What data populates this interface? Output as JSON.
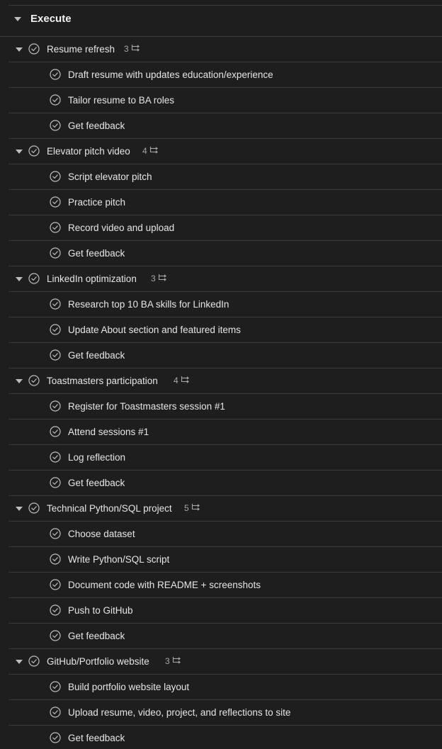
{
  "section": {
    "title": "Execute"
  },
  "groups": [
    {
      "title": "Resume refresh",
      "count": "3",
      "items": [
        "Draft resume with updates education/experience",
        "Tailor resume to BA roles",
        "Get feedback"
      ]
    },
    {
      "title": "Elevator pitch video",
      "count": "4",
      "items": [
        "Script elevator pitch",
        "Practice pitch",
        "Record video and upload",
        "Get feedback"
      ]
    },
    {
      "title": "LinkedIn optimization",
      "count": "3",
      "items": [
        "Research top 10 BA skills for LinkedIn",
        "Update About section and featured items",
        "Get feedback"
      ]
    },
    {
      "title": "Toastmasters participation",
      "count": "4",
      "items": [
        "Register for Toastmasters session #1",
        "Attend sessions #1",
        "Log reflection",
        "Get feedback"
      ]
    },
    {
      "title": "Technical Python/SQL project",
      "count": "5",
      "items": [
        "Choose dataset",
        "Write Python/SQL script",
        "Document code with README + screenshots",
        "Push to GitHub",
        "Get feedback"
      ]
    },
    {
      "title": "GitHub/Portfolio website",
      "count": "3",
      "items": [
        "Build portfolio website layout",
        "Upload resume, video, project, and reflections to site",
        "Get feedback"
      ]
    }
  ],
  "icons": {
    "check": "check-circle-icon",
    "subtasks": "subtask-icon",
    "expand": "chevron-down-icon"
  },
  "colors": {
    "background": "#1e1e1e",
    "divider": "#3a3a3a",
    "text": "#e6e6e6",
    "muted": "#a8a8a8"
  }
}
